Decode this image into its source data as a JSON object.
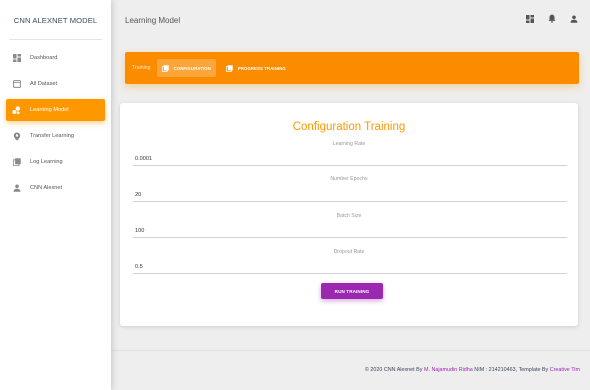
{
  "sidebar": {
    "brand": "CNN ALEXNET MODEL",
    "items": [
      {
        "label": "Dashboard",
        "icon": "dashboard-icon"
      },
      {
        "label": "All Dataset",
        "icon": "file-icon"
      },
      {
        "label": "Learning Model",
        "icon": "bubble-chart-icon",
        "active": true
      },
      {
        "label": "Transfer Learning",
        "icon": "location-pin-icon"
      },
      {
        "label": "Log Learning",
        "icon": "library-books-icon"
      },
      {
        "label": "CNN Alexnet",
        "icon": "person-icon"
      }
    ]
  },
  "topbar": {
    "title": "Learning Model",
    "icons": [
      "dashboard-icon",
      "notifications-icon",
      "person-icon"
    ]
  },
  "tabs": {
    "prefix": "Training",
    "items": [
      {
        "label": "CONFIGURATION",
        "icon": "library-books-icon",
        "active": true
      },
      {
        "label": "PROGRESS TRAINING",
        "icon": "library-books-icon",
        "active": false
      }
    ]
  },
  "form": {
    "title": "Configuration Training",
    "fields": [
      {
        "label": "Learning Rate",
        "value": "0.0001"
      },
      {
        "label": "Number Epochs",
        "value": "20"
      },
      {
        "label": "Batch Size",
        "value": "100"
      },
      {
        "label": "Dropout Rate",
        "value": "0.5"
      }
    ],
    "submit_label": "RUN TRAINING"
  },
  "footer": {
    "prefix": "© 2020 CNN Alexnet By ",
    "author": "M. Najamudin Ridha",
    "middle": " NIM : 214210463, Template By ",
    "template_author": "Creative Tim"
  },
  "colors": {
    "accent": "#ff9800",
    "button": "#9c27b0",
    "link": "#9c27b0"
  }
}
